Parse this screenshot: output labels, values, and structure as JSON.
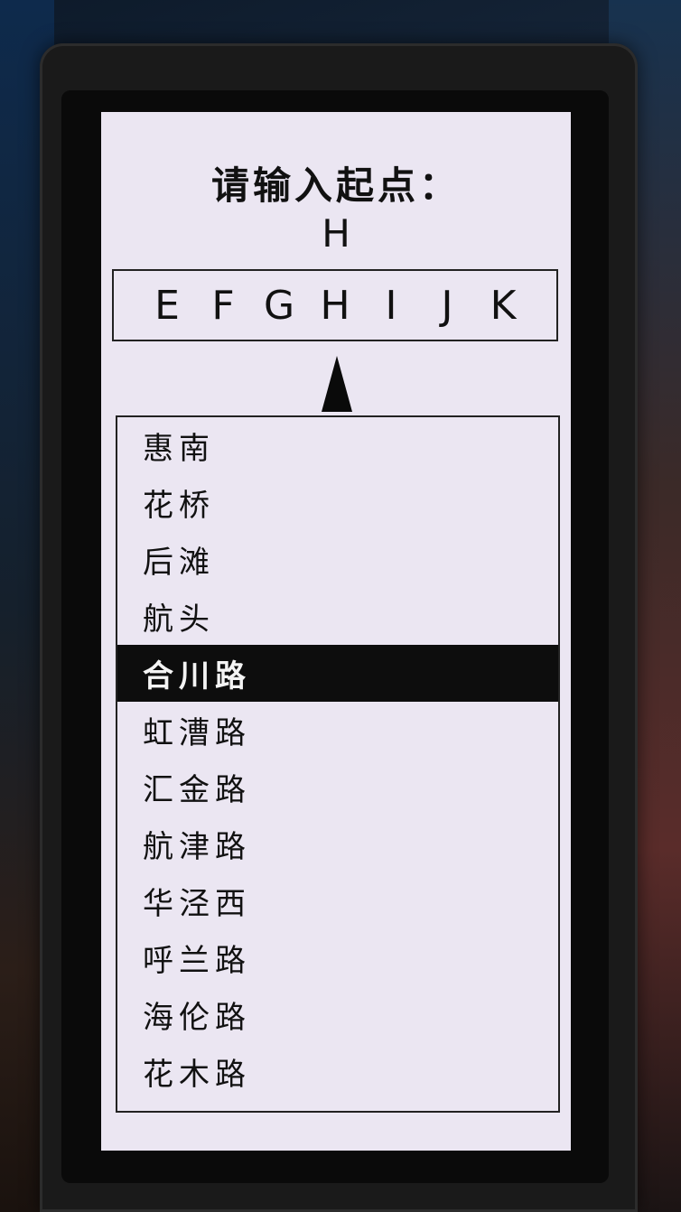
{
  "prompt": "请输入起点：",
  "current_input": "H",
  "letters": [
    "E",
    "F",
    "G",
    "H",
    "I",
    "J",
    "K"
  ],
  "stations": [
    "惠南",
    "花桥",
    "后滩",
    "航头",
    "合川路",
    "虹漕路",
    "汇金路",
    "航津路",
    "华泾西",
    "呼兰路",
    "海伦路",
    "花木路"
  ],
  "selected_index": 4
}
